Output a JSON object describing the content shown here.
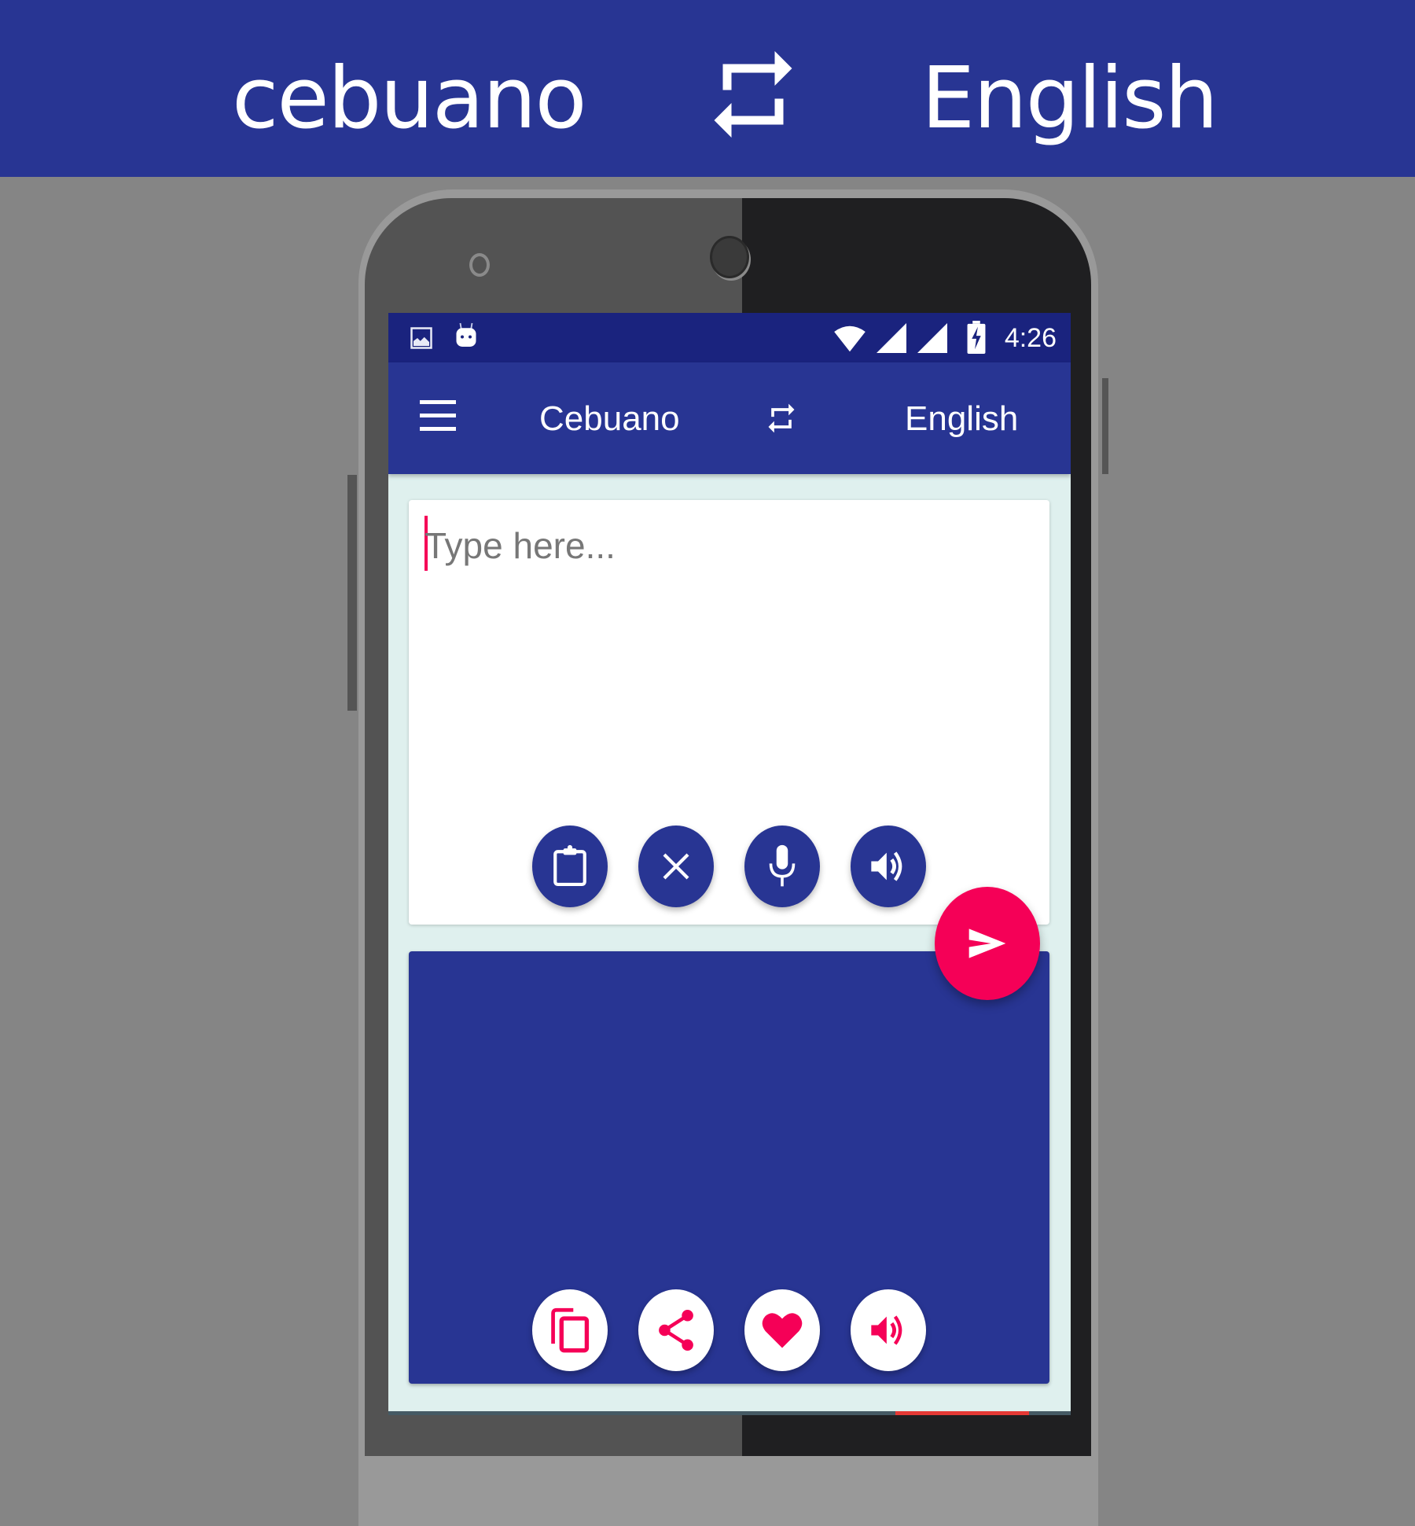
{
  "banner": {
    "source_language": "cebuano",
    "target_language": "English",
    "swap_icon": "swap-arrows-icon"
  },
  "statusbar": {
    "left_icons": [
      "gallery-icon",
      "android-icon"
    ],
    "right_icons": [
      "wifi-icon",
      "signal-icon",
      "signal-icon",
      "battery-charging-icon"
    ],
    "time": "4:26"
  },
  "appbar": {
    "menu_icon": "hamburger-menu-icon",
    "source_language": "Cebuano",
    "swap_icon": "swap-arrows-icon",
    "target_language": "English"
  },
  "input": {
    "value": "",
    "placeholder": "Type here...",
    "actions": [
      {
        "name": "paste",
        "icon": "clipboard-icon"
      },
      {
        "name": "clear",
        "icon": "close-icon"
      },
      {
        "name": "voice-input",
        "icon": "microphone-icon"
      },
      {
        "name": "speak",
        "icon": "speaker-icon"
      }
    ]
  },
  "translate_button": {
    "icon": "send-icon"
  },
  "output": {
    "text": "",
    "actions": [
      {
        "name": "copy",
        "icon": "copy-icon"
      },
      {
        "name": "share",
        "icon": "share-icon"
      },
      {
        "name": "favorite",
        "icon": "heart-icon"
      },
      {
        "name": "speak",
        "icon": "speaker-icon"
      }
    ]
  },
  "colors": {
    "primary": "#283593",
    "primary_dark": "#1a237e",
    "accent": "#f50057",
    "background": "#dff0ee",
    "outer_background": "#858585"
  }
}
